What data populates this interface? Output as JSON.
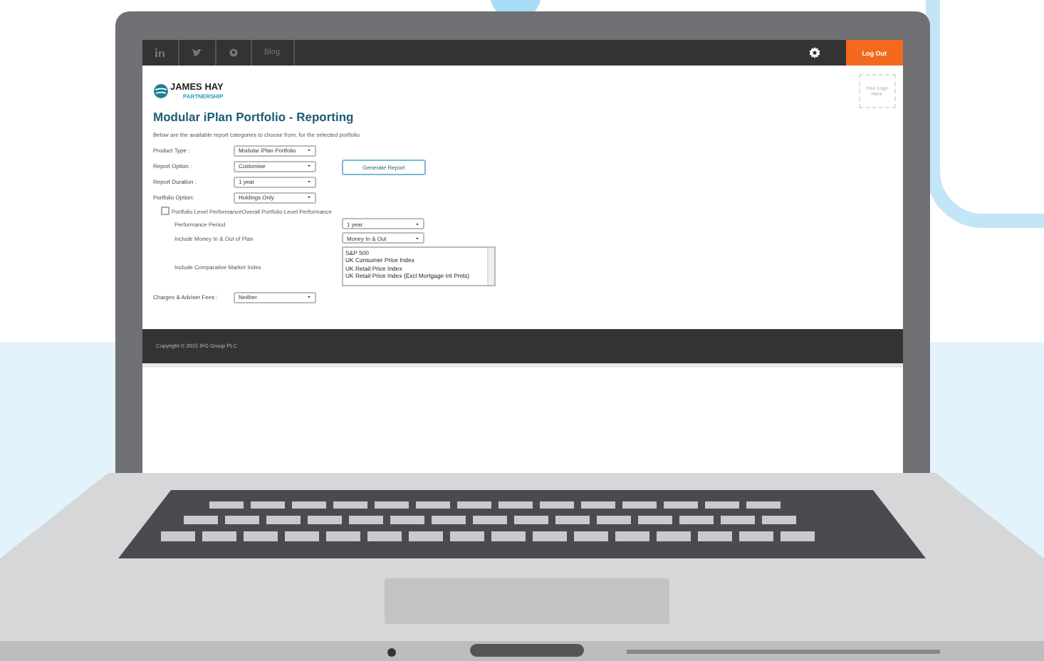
{
  "topbar": {
    "link": "Blog",
    "logout": "Log Out"
  },
  "brand": {
    "name": "JAMES HAY",
    "sub": "PARTNERSHIP"
  },
  "logo_slot": "Your Logo Here",
  "title": "Modular iPlan Portfolio - Reporting",
  "intro": "Below are the available report categories to choose from, for the selected portfolio",
  "fields": [
    {
      "label": "Product Type :",
      "value": "Modular iPlan Portfolio"
    },
    {
      "label": "Report Option :",
      "value": "Customise"
    },
    {
      "label": "Report Duration :",
      "value": "1 year"
    },
    {
      "label": "Portfolio Option:",
      "value": "Holdings Only"
    }
  ],
  "generate_button": "Generate Report",
  "option": {
    "label": "Portfolio Level PerformanceOverall Portfolio Level Performance",
    "checked": false
  },
  "sub_fields": [
    {
      "label": "Performance Period",
      "value": "1 year"
    },
    {
      "label": "Include Money In & Out of Plan",
      "value": "Money In & Out"
    }
  ],
  "index": {
    "label": "Include Comparative Market Index",
    "options": [
      "S&P 500",
      "UK Consumer Price Index",
      "UK Retail Price Index",
      "UK Retail Price Index (Excl Mortgage Int Pmts)"
    ]
  },
  "fees": {
    "label": "Charges & Adviser Fees :",
    "value": "Neither"
  },
  "footer": "Copyright © 2015 IFG Group PLC"
}
